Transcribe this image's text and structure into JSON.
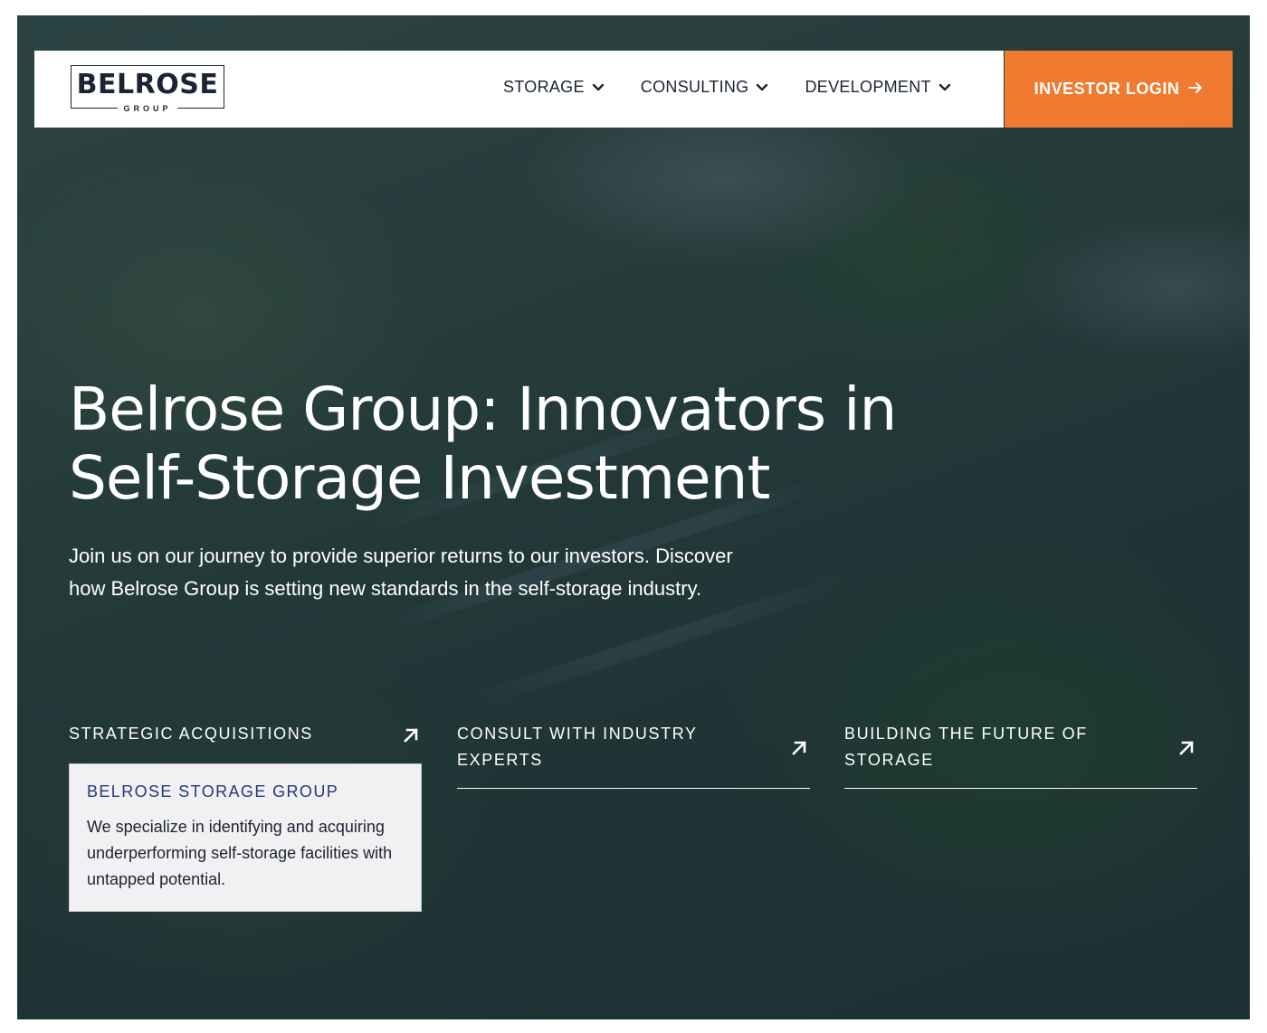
{
  "brand": {
    "logo_text": "BELROSE",
    "logo_subtext": "GROUP",
    "accent_color": "#ef7a30",
    "heading_blue": "#233a7a"
  },
  "nav": {
    "items": [
      {
        "label": "STORAGE",
        "icon": "chevron-down-icon"
      },
      {
        "label": "CONSULTING",
        "icon": "chevron-down-icon"
      },
      {
        "label": "DEVELOPMENT",
        "icon": "chevron-down-icon"
      }
    ],
    "cta_label": "INVESTOR LOGIN",
    "cta_icon": "arrow-right-icon"
  },
  "hero": {
    "title_line1": "Belrose Group: Innovators in",
    "title_line2": "Self-Storage Investment",
    "description": "Join us on our journey to provide superior returns to our investors. Discover how Belrose Group is setting new standards in the self-storage industry."
  },
  "services": [
    {
      "title": "STRATEGIC ACQUISITIONS",
      "icon": "arrow-up-right-icon",
      "card_title": "BELROSE STORAGE GROUP",
      "card_text": "We specialize in identifying and acquiring underperforming self-storage facilities with untapped potential."
    },
    {
      "title": "CONSULT WITH INDUSTRY EXPERTS",
      "icon": "arrow-up-right-icon"
    },
    {
      "title": "BUILDING THE FUTURE OF STORAGE",
      "icon": "arrow-up-right-icon"
    }
  ]
}
